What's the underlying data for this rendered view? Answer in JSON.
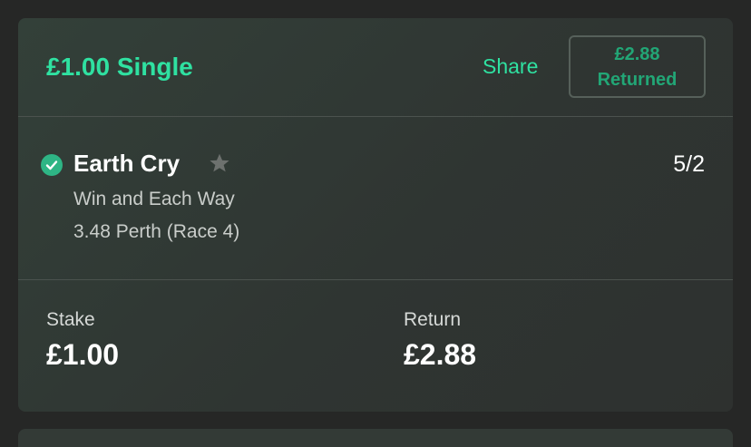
{
  "bet": {
    "title": "£1.00 Single",
    "share_label": "Share",
    "returned_amount": "£2.88",
    "returned_label": "Returned"
  },
  "selection": {
    "runner": "Earth Cry",
    "odds": "5/2",
    "market": "Win and Each Way",
    "event": "3.48 Perth (Race 4)",
    "status_icon": "check-circle-icon",
    "favourite_icon": "star-icon"
  },
  "summary": {
    "stake_label": "Stake",
    "stake_value": "£1.00",
    "return_label": "Return",
    "return_value": "£2.88"
  },
  "colors": {
    "accent": "#2fe1a1",
    "returned_text": "#22a676",
    "check": "#2eb585",
    "background": "#262726"
  }
}
